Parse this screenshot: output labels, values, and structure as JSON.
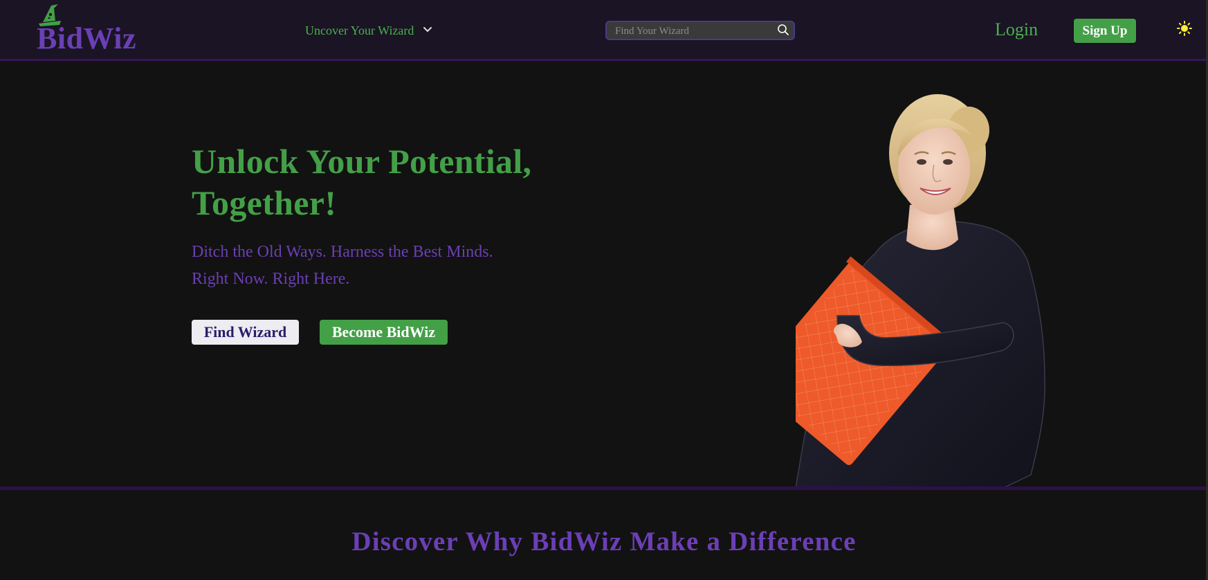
{
  "brand": {
    "name": "BidWiz",
    "logo_icon": "wizard-hat-icon",
    "primary_color": "#6b3fb5",
    "accent_color": "#43a047"
  },
  "nav": {
    "dropdown_label": "Uncover Your Wizard",
    "dropdown_icon": "chevron-down-icon",
    "search_placeholder": "Find Your Wizard",
    "search_value": "",
    "search_icon": "search-icon",
    "login_label": "Login",
    "signup_label": "Sign Up",
    "theme_icon": "sun-icon"
  },
  "hero": {
    "title": "Unlock Your Potential, Together!",
    "subtitle_line1": "Ditch the Old Ways. Harness the Best Minds.",
    "subtitle_line2": "Right Now. Right Here.",
    "primary_button": "Find Wizard",
    "secondary_button": "Become BidWiz",
    "image_subject": "smiling woman holding orange folder"
  },
  "why": {
    "title": "Discover Why BidWiz Make a Difference"
  }
}
